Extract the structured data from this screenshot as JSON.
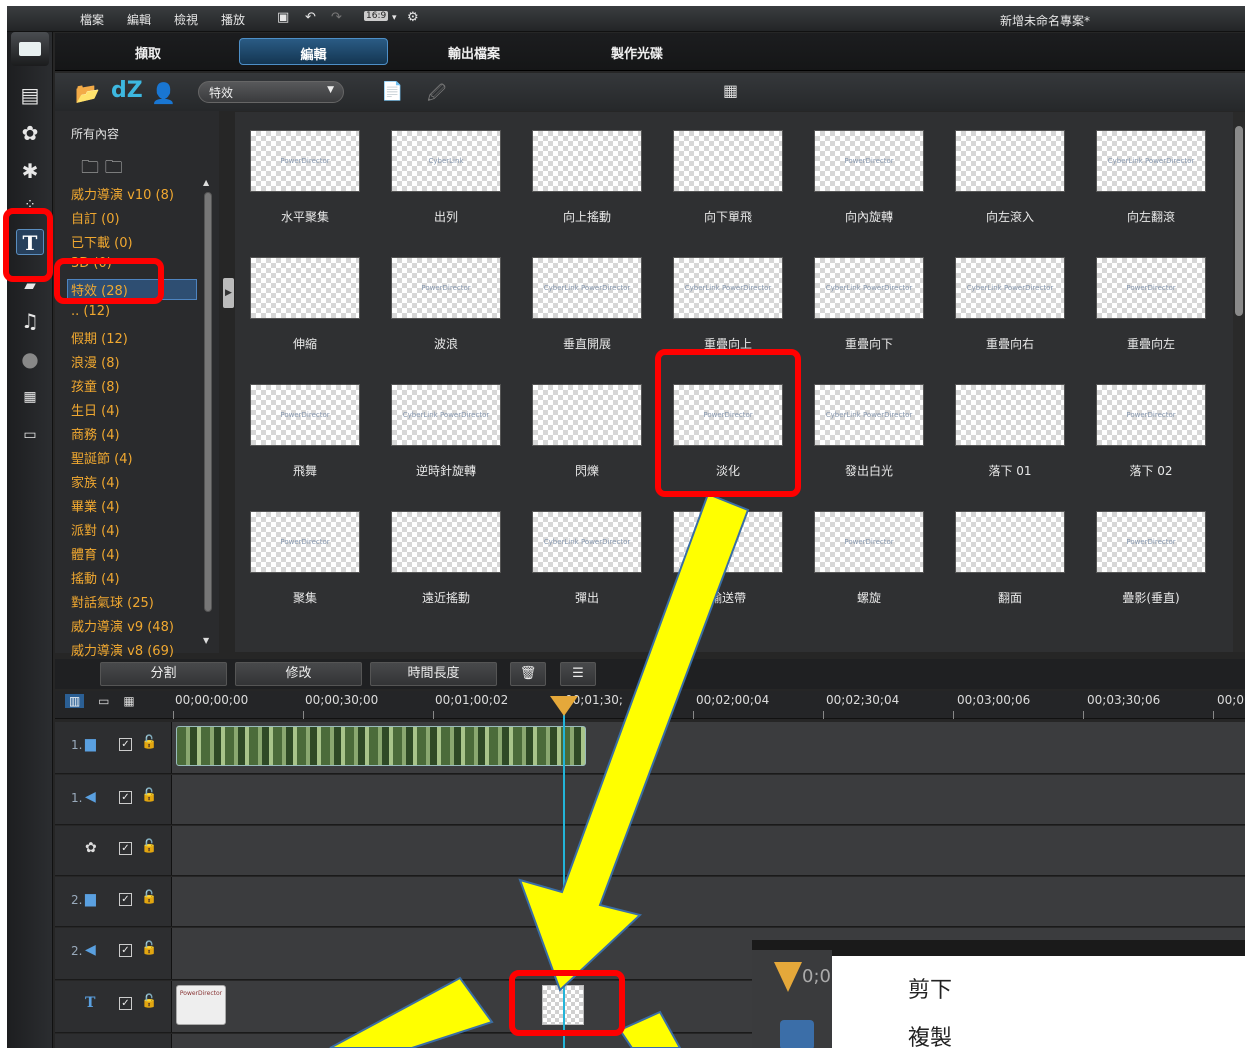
{
  "app": {
    "project_title": "新增未命名專案*",
    "menus": [
      "檔案",
      "編輯",
      "檢視",
      "播放"
    ],
    "aspect_ratio": "16:9"
  },
  "modes": {
    "capture": "擷取",
    "edit": "編輯",
    "produce": "輸出檔案",
    "disc": "製作光碟"
  },
  "library": {
    "dropdown_value": "特效",
    "dz_label": "dZ"
  },
  "tree": {
    "all_content": "所有內容",
    "items": [
      {
        "label": "威力導演 v10  (8)"
      },
      {
        "label": "自訂  (0)"
      },
      {
        "label": "已下載  (0)"
      },
      {
        "label": "3D  (0)"
      },
      {
        "label": "特效  (28)"
      },
      {
        "label": "..  (12)"
      },
      {
        "label": "假期  (12)"
      },
      {
        "label": "浪漫  (8)"
      },
      {
        "label": "孩童  (8)"
      },
      {
        "label": "生日  (4)"
      },
      {
        "label": "商務  (4)"
      },
      {
        "label": "聖誕節  (4)"
      },
      {
        "label": "家族  (4)"
      },
      {
        "label": "畢業  (4)"
      },
      {
        "label": "派對  (4)"
      },
      {
        "label": "體育  (4)"
      },
      {
        "label": "搖動  (4)"
      },
      {
        "label": "對話氣球  (25)"
      },
      {
        "label": "威力導演 v9  (48)"
      },
      {
        "label": "威力導演 v8  (69)"
      }
    ]
  },
  "effects": [
    {
      "label": "水平聚集",
      "thumb": "PowerDirector"
    },
    {
      "label": "出列",
      "thumb": "CyberLink"
    },
    {
      "label": "向上搖動",
      "thumb": ""
    },
    {
      "label": "向下單飛",
      "thumb": ""
    },
    {
      "label": "向內旋轉",
      "thumb": "PowerDirector"
    },
    {
      "label": "向左滾入",
      "thumb": ""
    },
    {
      "label": "向左翻滾",
      "thumb": "CyberLink PowerDirector"
    },
    {
      "label": "伸縮",
      "thumb": ""
    },
    {
      "label": "波浪",
      "thumb": "PowerDirector"
    },
    {
      "label": "垂直開展",
      "thumb": "CyberLink PowerDirector"
    },
    {
      "label": "重疊向上",
      "thumb": "CyberLink PowerDirector"
    },
    {
      "label": "重疊向下",
      "thumb": "CyberLink PowerDirector"
    },
    {
      "label": "重疊向右",
      "thumb": "CyberLink PowerDirector"
    },
    {
      "label": "重疊向左",
      "thumb": "PowerDirector"
    },
    {
      "label": "飛舞",
      "thumb": "PowerDirector"
    },
    {
      "label": "逆時針旋轉",
      "thumb": "CyberLink PowerDirector"
    },
    {
      "label": "閃爍",
      "thumb": ""
    },
    {
      "label": "淡化",
      "thumb": "PowerDirector"
    },
    {
      "label": "發出白光",
      "thumb": "CyberLink PowerDirector"
    },
    {
      "label": "落下 01",
      "thumb": ""
    },
    {
      "label": "落下 02",
      "thumb": "PowerDirector"
    },
    {
      "label": "聚集",
      "thumb": "PowerDirector"
    },
    {
      "label": "遠近搖動",
      "thumb": ""
    },
    {
      "label": "彈出",
      "thumb": "CyberLink PowerDirector"
    },
    {
      "label": "輸送帶",
      "thumb": ""
    },
    {
      "label": "螺旋",
      "thumb": "PowerDirector"
    },
    {
      "label": "翻面",
      "thumb": ""
    },
    {
      "label": "疊影(垂直)",
      "thumb": "PowerDirector"
    }
  ],
  "timeline_toolbar": {
    "split": "分割",
    "modify": "修改",
    "duration": "時間長度"
  },
  "ruler": [
    "00;00;00;00",
    "00;00;30;00",
    "00;01;00;02",
    "00;01;30;",
    "00;02;00;04",
    "00;02;30;04",
    "00;03;00;06",
    "00;03;30;06",
    "00;0"
  ],
  "tracks": [
    {
      "num": "1.",
      "icon": "video-track-icon",
      "glyph": "▆"
    },
    {
      "num": "1.",
      "icon": "audio-track-icon",
      "glyph": "◀"
    },
    {
      "num": "",
      "icon": "effect-track-icon",
      "glyph": "✿"
    },
    {
      "num": "2.",
      "icon": "video-track-icon",
      "glyph": "▆"
    },
    {
      "num": "2.",
      "icon": "audio-track-icon",
      "glyph": "◀"
    },
    {
      "num": "",
      "icon": "title-track-icon",
      "glyph": "T"
    },
    {
      "num": "",
      "icon": "voice-track-icon",
      "glyph": "●"
    }
  ],
  "context_menu": {
    "items": [
      "剪下",
      "複製"
    ],
    "marker_text": "0;0"
  },
  "title_clip_text": "PowerDirector",
  "colors": {
    "highlight": "#ff0000",
    "arrow": "#ffff00",
    "category_text": "#f0a830",
    "playhead": "#23b4d8"
  }
}
